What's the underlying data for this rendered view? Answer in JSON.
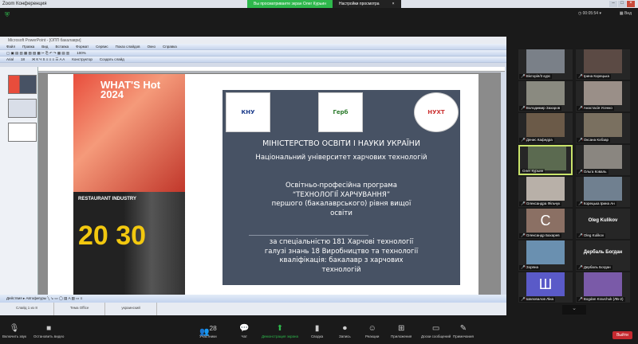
{
  "window": {
    "title": "Zoom Конференция",
    "controls": [
      "–",
      "□",
      "×"
    ]
  },
  "banner": {
    "viewing": "Вы просматриваете экран Олег Курьин",
    "options": "Настройки просмотра",
    "close": "×"
  },
  "top": {
    "clock": "00:05:54",
    "view": "Вид"
  },
  "ppt": {
    "title": "Microsoft PowerPoint - [ОПП бакалаври]",
    "menu": [
      "Файл",
      "Правка",
      "Вид",
      "Вставка",
      "Формат",
      "Сервис",
      "Показ слайдов",
      "Окно",
      "Справка"
    ],
    "toolbar2": [
      "100%"
    ],
    "toolbar3": [
      "Arial",
      "18",
      "Конструктор",
      "Создать слайд"
    ],
    "drawbar": [
      "Действия",
      "Автофигуры"
    ],
    "status": [
      "Слайд 1 из 8",
      "Тема Office",
      "украинский"
    ]
  },
  "slide": {
    "poster1": "WHAT'S Hot 2024",
    "poster2_label": "RESTAURANT INDUSTRY",
    "poster2_num": "20 30",
    "logos": [
      "КНУ",
      "Герб",
      "НУХТ"
    ],
    "line1": "МІНІСТЕРСТВО ОСВІТИ І НАУКИ УКРАЇНИ",
    "line2": "Національний університет харчових технологій",
    "line3": [
      "Освітньо-професійна програма",
      "“ТЕХНОЛОГІЇ ХАРЧУВАННЯ”",
      "першого (бакалаврського) рівня вищої",
      "освіти"
    ],
    "line4": [
      "за спеціальністю 181 Харчові технології",
      "галузі знань 18 Виробництво та технології",
      "кваліфікація: бакалавр з харчових",
      "технологій"
    ]
  },
  "participants": [
    {
      "name": "Вікторія/3 курс"
    },
    {
      "name": "Ірина Корецька"
    },
    {
      "name": "Володимир Захаров"
    },
    {
      "name": "Анастасія Усенко"
    },
    {
      "name": "Денис Кафедра"
    },
    {
      "name": "Оксана Кобзар"
    },
    {
      "name": "Олег Курьин"
    },
    {
      "name": "Ольга Коваль"
    },
    {
      "name": "Олександра Фільчук"
    },
    {
      "name": "Корецька Ірина Ан"
    },
    {
      "name": "Олександр Бахарев",
      "initial": "С"
    },
    {
      "name": "Oleg Kulikov",
      "big": "Oleg Kulikov"
    },
    {
      "name": "Зоряна"
    },
    {
      "name": "Дербаль Богдан",
      "big": "Дербаль Богдан"
    },
    {
      "name": "Шаповалов Ліна",
      "initial": "Ш"
    },
    {
      "name": "Bogdan Kravchuk (ЛБ-2)"
    }
  ],
  "more": "⌄",
  "controls": [
    {
      "label": "Включить звук",
      "icon": "🎙"
    },
    {
      "label": "Остановить видео",
      "icon": "■"
    },
    {
      "label": "Участники",
      "icon": "👥"
    },
    {
      "label": "Чат",
      "icon": "💬"
    },
    {
      "label": "Демонстрация экрана",
      "icon": "⬆"
    },
    {
      "label": "Сводка",
      "icon": "▮"
    },
    {
      "label": "Запись",
      "icon": "⏺"
    },
    {
      "label": "Реакции",
      "icon": "☺"
    },
    {
      "label": "Приложения",
      "icon": "⊞"
    },
    {
      "label": "Доски сообщений",
      "icon": "▭"
    },
    {
      "label": "Примечания",
      "icon": "✎"
    }
  ],
  "participants_count": "28",
  "leave": "Выйти"
}
